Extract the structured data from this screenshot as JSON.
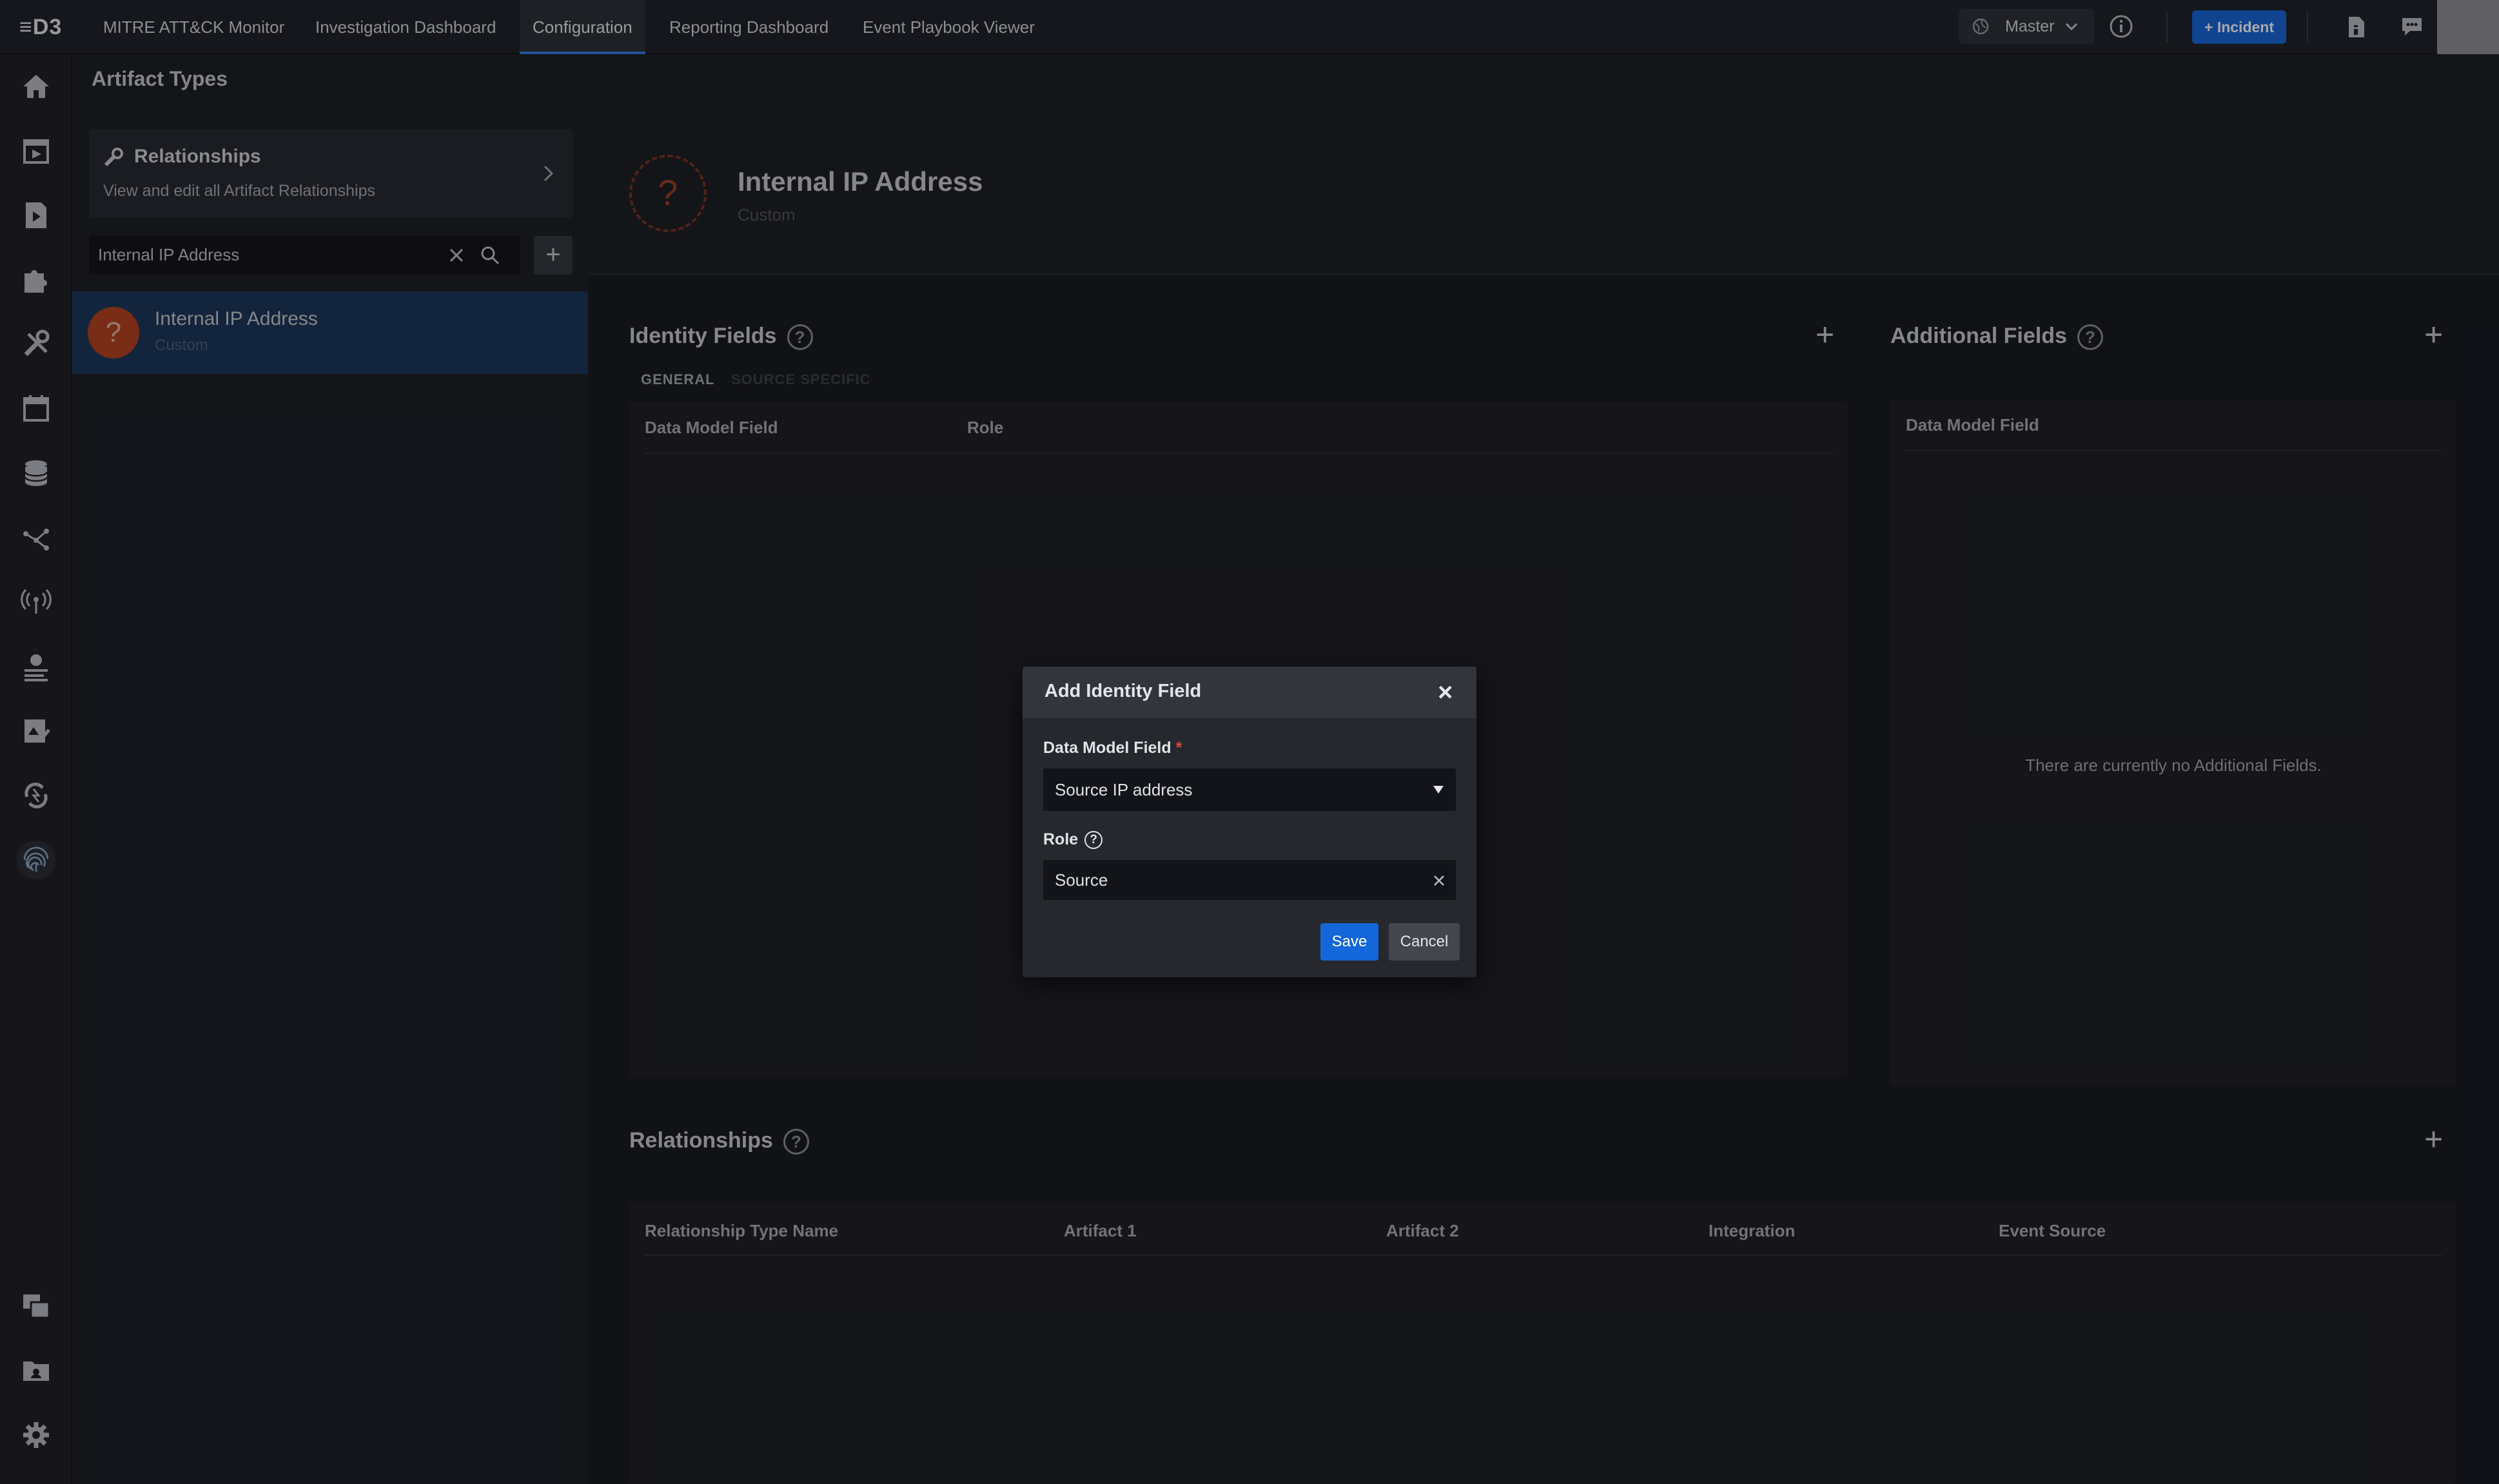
{
  "topbar": {
    "logo": "≡D3",
    "nav": [
      "MITRE ATT&CK Monitor",
      "Investigation Dashboard",
      "Configuration",
      "Reporting Dashboard",
      "Event Playbook Viewer"
    ],
    "active_nav": "Configuration",
    "master_label": "Master",
    "incident_label": "+ Incident",
    "accent_color": "#1467d9"
  },
  "sidebar": {
    "icons": [
      "home-icon",
      "incident-calendar-icon",
      "playbook-icon",
      "integration-puzzle-icon",
      "tools-icon",
      "calendar-icon",
      "database-icon",
      "relationship-graph-icon",
      "signal-icon",
      "globe-list-icon",
      "report-icon",
      "sync-icon",
      "fingerprint-icon",
      "windows-icon",
      "folder-icon",
      "settings-icon"
    ]
  },
  "panel": {
    "title": "Artifact Types",
    "relationships_card": {
      "title": "Relationships",
      "subtitle": "View and edit all Artifact Relationships"
    },
    "search_value": "Internal IP Address",
    "items": [
      {
        "name": "Internal IP Address",
        "type": "Custom",
        "icon_text": "?",
        "icon_color": "#b63f1d"
      }
    ]
  },
  "artifact": {
    "icon_text": "?",
    "name": "Internal IP Address",
    "type": "Custom"
  },
  "identity_fields": {
    "title": "Identity Fields",
    "tabs": [
      "GENERAL",
      "SOURCE SPECIFIC"
    ],
    "columns": [
      "Data Model Field",
      "Role"
    ]
  },
  "additional_fields": {
    "title": "Additional Fields",
    "columns": [
      "Data Model Field"
    ],
    "empty_text": "There are currently no Additional Fields."
  },
  "relationships": {
    "title": "Relationships",
    "columns": [
      "Relationship Type Name",
      "Artifact 1",
      "Artifact 2",
      "Integration",
      "Event Source"
    ]
  },
  "modal": {
    "title": "Add Identity Field",
    "close_glyph": "×",
    "data_model_label": "Data Model Field",
    "required_mark": "*",
    "data_model_value": "Source IP address",
    "role_label": "Role",
    "role_value": "Source",
    "save_label": "Save",
    "cancel_label": "Cancel"
  }
}
